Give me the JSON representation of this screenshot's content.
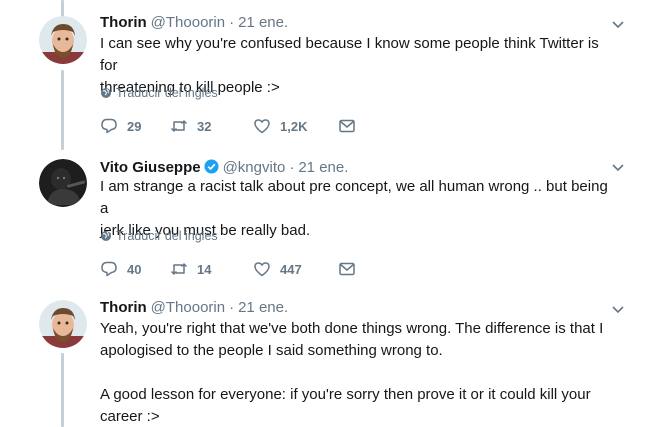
{
  "tweets": [
    {
      "name": "Thorin",
      "handle": "@Thooorin",
      "separator": "·",
      "date": "21 ene.",
      "text_lines": [
        "I can see why you're confused because I know some people think Twitter is for",
        "threatening to kill people :>"
      ],
      "translate": "Traducir del inglés",
      "replies": "29",
      "retweets": "32",
      "likes": "1,2K",
      "avatar": "thorin-avatar",
      "verified": false
    },
    {
      "name": "Vito Giuseppe",
      "handle": "@kngvito",
      "separator": "·",
      "date": "21 ene.",
      "text_lines": [
        "I am strange a racist talk about pre concept, we all human wrong .. but being a",
        "jerk like you must be really bad."
      ],
      "translate": "Traducir del inglés",
      "replies": "40",
      "retweets": "14",
      "likes": "447",
      "avatar": "vito-avatar",
      "verified": true
    },
    {
      "name": "Thorin",
      "handle": "@Thooorin",
      "separator": "·",
      "date": "21 ene.",
      "text_lines": [
        "Yeah, you're right that we've both done things wrong. The difference is that I",
        "apologised to the people I said something wrong to.",
        "",
        "A good lesson for everyone: if you're sorry then prove it or it could kill your",
        "career :>"
      ],
      "avatar": "thorin-avatar",
      "verified": false
    }
  ],
  "colors": {
    "text": "#14171a",
    "secondary": "#657786",
    "thread_line": "#c4cfd6",
    "verified": "#1da1f2"
  },
  "icons": [
    "reply-icon",
    "retweet-icon",
    "like-icon",
    "dm-icon",
    "globe-icon",
    "chevron-down-icon",
    "verified-badge-icon"
  ]
}
